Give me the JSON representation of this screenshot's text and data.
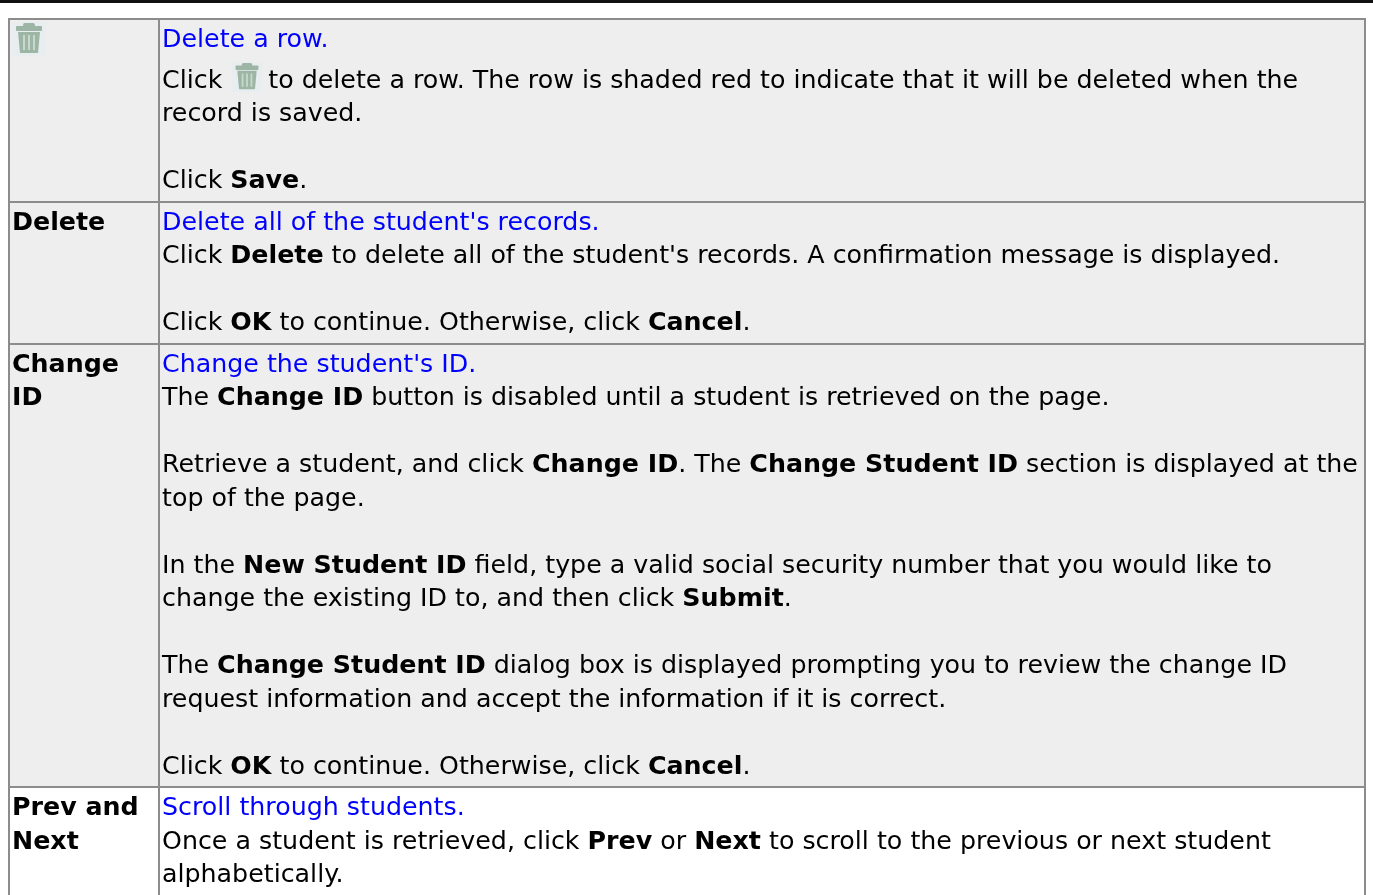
{
  "rows": [
    {
      "kind": "icon",
      "shaded": true,
      "link": "Delete a row.",
      "paragraphs": [
        {
          "kind": "icon_text",
          "before": "Click",
          "after": "to delete a row. The row is shaded red to indicate that it will be deleted when the record is saved."
        },
        {
          "kind": "text",
          "text": "Click **Save**."
        }
      ]
    },
    {
      "kind": "text",
      "label": "Delete",
      "shaded": true,
      "link": "Delete all of the student's records.",
      "paragraphs": [
        {
          "kind": "text",
          "text": "Click **Delete** to delete all of the student's records. A confirmation message is displayed."
        },
        {
          "kind": "text",
          "text": "Click **OK** to continue. Otherwise, click **Cancel**."
        }
      ]
    },
    {
      "kind": "text",
      "label": "Change ID",
      "shaded": true,
      "link": "Change the student's ID.",
      "paragraphs": [
        {
          "kind": "text",
          "text": "The **Change ID** button is disabled until a student is retrieved on the page."
        },
        {
          "kind": "text",
          "text": "Retrieve a student, and click **Change ID**. The **Change Student ID** section is displayed at the top of the page."
        },
        {
          "kind": "text",
          "text": "In the **New Student ID** field, type a valid social security number that you would like to change the existing ID to, and then click **Submit**."
        },
        {
          "kind": "text",
          "text": "The **Change Student ID** dialog box is displayed prompting you to review the change ID request information and accept the information if it is correct."
        },
        {
          "kind": "text",
          "text": "Click **OK** to continue. Otherwise, click **Cancel**."
        }
      ]
    },
    {
      "kind": "text",
      "label": "Prev and Next",
      "shaded": false,
      "link": "Scroll through students.",
      "paragraphs": [
        {
          "kind": "text",
          "text": "Once a student is retrieved, click **Prev** or **Next** to scroll to the previous or next student alphabetically."
        }
      ]
    }
  ]
}
